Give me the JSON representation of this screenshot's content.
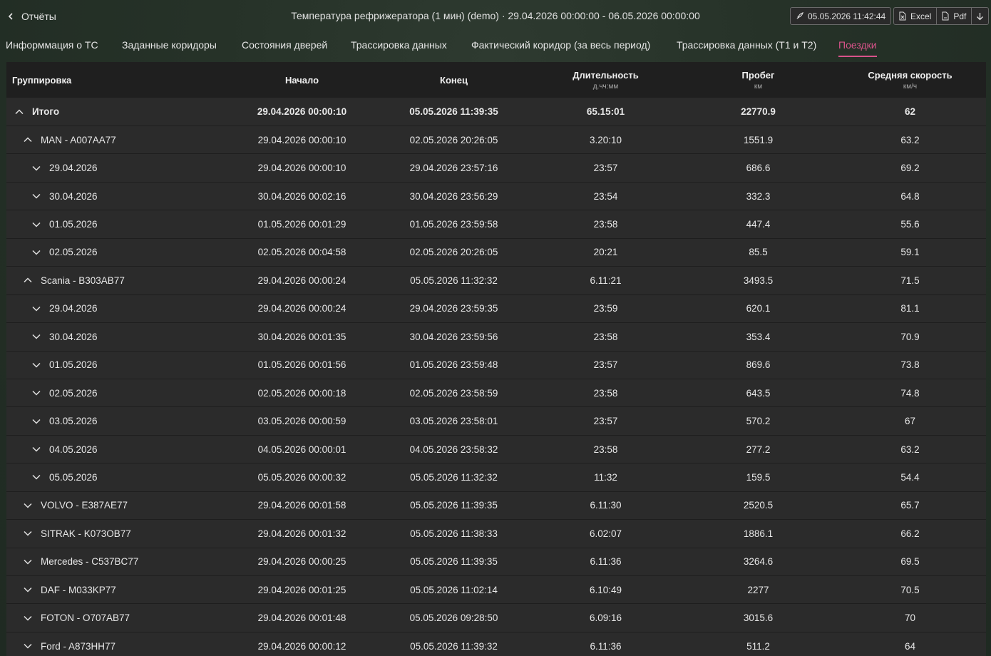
{
  "header": {
    "back_label": "Отчёты",
    "title": "Температура рефрижератора (1 мин) (demo) · 29.04.2026 00:00:00 - 06.05.2026 00:00:00",
    "timestamp": "05.05.2026 11:42:44",
    "excel_label": "Excel",
    "pdf_label": "Pdf"
  },
  "tabs": [
    {
      "label": "Информмация о ТС"
    },
    {
      "label": "Заданные коридоры"
    },
    {
      "label": "Состояния дверей"
    },
    {
      "label": "Трассировка данных"
    },
    {
      "label": "Фактический коридор (за весь период)"
    },
    {
      "label": "Трассировка данных (Т1 и Т2)"
    },
    {
      "label": "Поездки"
    }
  ],
  "active_tab": "Поездки",
  "colors": {
    "accent": "#d9538a",
    "header_bg": "#1f1f1f",
    "row_bg": "#2b2b2b"
  },
  "columns": [
    {
      "label": "Группировка",
      "unit": ""
    },
    {
      "label": "Начало",
      "unit": ""
    },
    {
      "label": "Конец",
      "unit": ""
    },
    {
      "label": "Длительность",
      "unit": "д.чч:мм"
    },
    {
      "label": "Пробег",
      "unit": "км"
    },
    {
      "label": "Средняя скорость",
      "unit": "км/ч"
    }
  ],
  "rows": [
    {
      "level": 0,
      "icon": "chevron-up-icon",
      "cells": [
        "Итого",
        "29.04.2026 00:00:10",
        "05.05.2026 11:39:35",
        "65.15:01",
        "22770.9",
        "62"
      ]
    },
    {
      "level": 1,
      "icon": "chevron-up-icon",
      "cells": [
        "MAN - A007AA77",
        "29.04.2026 00:00:10",
        "02.05.2026 20:26:05",
        "3.20:10",
        "1551.9",
        "63.2"
      ]
    },
    {
      "level": 2,
      "icon": "chevron-down-icon",
      "cells": [
        "29.04.2026",
        "29.04.2026 00:00:10",
        "29.04.2026 23:57:16",
        "23:57",
        "686.6",
        "69.2"
      ]
    },
    {
      "level": 2,
      "icon": "chevron-down-icon",
      "cells": [
        "30.04.2026",
        "30.04.2026 00:02:16",
        "30.04.2026 23:56:29",
        "23:54",
        "332.3",
        "64.8"
      ]
    },
    {
      "level": 2,
      "icon": "chevron-down-icon",
      "cells": [
        "01.05.2026",
        "01.05.2026 00:01:29",
        "01.05.2026 23:59:58",
        "23:58",
        "447.4",
        "55.6"
      ]
    },
    {
      "level": 2,
      "icon": "chevron-down-icon",
      "cells": [
        "02.05.2026",
        "02.05.2026 00:04:58",
        "02.05.2026 20:26:05",
        "20:21",
        "85.5",
        "59.1"
      ]
    },
    {
      "level": 1,
      "icon": "chevron-up-icon",
      "cells": [
        "Scania - B303AB77",
        "29.04.2026 00:00:24",
        "05.05.2026 11:32:32",
        "6.11:21",
        "3493.5",
        "71.5"
      ]
    },
    {
      "level": 2,
      "icon": "chevron-down-icon",
      "cells": [
        "29.04.2026",
        "29.04.2026 00:00:24",
        "29.04.2026 23:59:35",
        "23:59",
        "620.1",
        "81.1"
      ]
    },
    {
      "level": 2,
      "icon": "chevron-down-icon",
      "cells": [
        "30.04.2026",
        "30.04.2026 00:01:35",
        "30.04.2026 23:59:56",
        "23:58",
        "353.4",
        "70.9"
      ]
    },
    {
      "level": 2,
      "icon": "chevron-down-icon",
      "cells": [
        "01.05.2026",
        "01.05.2026 00:01:56",
        "01.05.2026 23:59:48",
        "23:57",
        "869.6",
        "73.8"
      ]
    },
    {
      "level": 2,
      "icon": "chevron-down-icon",
      "cells": [
        "02.05.2026",
        "02.05.2026 00:00:18",
        "02.05.2026 23:58:59",
        "23:58",
        "643.5",
        "74.8"
      ]
    },
    {
      "level": 2,
      "icon": "chevron-down-icon",
      "cells": [
        "03.05.2026",
        "03.05.2026 00:00:59",
        "03.05.2026 23:58:01",
        "23:57",
        "570.2",
        "67"
      ]
    },
    {
      "level": 2,
      "icon": "chevron-down-icon",
      "cells": [
        "04.05.2026",
        "04.05.2026 00:00:01",
        "04.05.2026 23:58:32",
        "23:58",
        "277.2",
        "63.2"
      ]
    },
    {
      "level": 2,
      "icon": "chevron-down-icon",
      "cells": [
        "05.05.2026",
        "05.05.2026 00:00:32",
        "05.05.2026 11:32:32",
        "11:32",
        "159.5",
        "54.4"
      ]
    },
    {
      "level": 1,
      "icon": "chevron-down-icon",
      "cells": [
        "VOLVO - E387AE77",
        "29.04.2026 00:01:58",
        "05.05.2026 11:39:35",
        "6.11:30",
        "2520.5",
        "65.7"
      ]
    },
    {
      "level": 1,
      "icon": "chevron-down-icon",
      "cells": [
        "SITRAK - K073OB77",
        "29.04.2026 00:01:32",
        "05.05.2026 11:38:33",
        "6.02:07",
        "1886.1",
        "66.2"
      ]
    },
    {
      "level": 1,
      "icon": "chevron-down-icon",
      "cells": [
        "Mercedes - C537BC77",
        "29.04.2026 00:00:25",
        "05.05.2026 11:39:35",
        "6.11:36",
        "3264.6",
        "69.5"
      ]
    },
    {
      "level": 1,
      "icon": "chevron-down-icon",
      "cells": [
        "DAF - M033KP77",
        "29.04.2026 00:01:25",
        "05.05.2026 11:02:14",
        "6.10:49",
        "2277",
        "70.5"
      ]
    },
    {
      "level": 1,
      "icon": "chevron-down-icon",
      "cells": [
        "FOTON - O707AB77",
        "29.04.2026 00:01:48",
        "05.05.2026 09:28:50",
        "6.09:16",
        "3015.6",
        "70"
      ]
    },
    {
      "level": 1,
      "icon": "chevron-down-icon",
      "cells": [
        "Ford - A873HH77",
        "29.04.2026 00:00:12",
        "05.05.2026 11:39:32",
        "6.11:36",
        "511.2",
        "64"
      ]
    }
  ]
}
